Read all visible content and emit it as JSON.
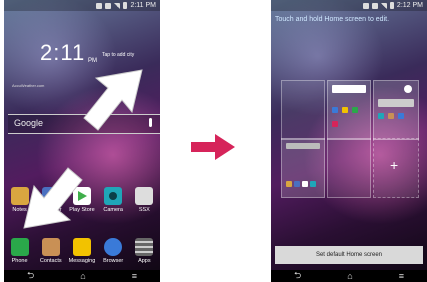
{
  "left_screen": {
    "status_time": "2:11 PM",
    "clock": "2:11",
    "clock_period": "PM",
    "tap_to_add_city": "Tap to add city",
    "weather_credit": "AccuWeather.com",
    "search_label": "Google",
    "app_row": [
      {
        "label": "Notes",
        "color": "#d9a640"
      },
      {
        "label": "xTheater",
        "color": "#4a70c0"
      },
      {
        "label": "Play Store",
        "color": "#ffffff"
      },
      {
        "label": "Camera",
        "color": "#1fa6b8"
      },
      {
        "label": "SSX",
        "color": "#dddddd"
      }
    ],
    "dock": [
      {
        "label": "Phone",
        "color": "#2aa84a"
      },
      {
        "label": "Contacts",
        "color": "#c99055"
      },
      {
        "label": "Messaging",
        "color": "#f2c200"
      },
      {
        "label": "Browser",
        "color": "#3a7ad8"
      },
      {
        "label": "Apps",
        "color": "#666666"
      }
    ]
  },
  "right_screen": {
    "status_time": "2:12 PM",
    "instruction": "Touch and hold Home screen to edit.",
    "add_symbol": "+",
    "set_default_label": "Set default Home screen"
  },
  "nav": {
    "back": "⮌",
    "home": "⌂",
    "menu": "≡"
  },
  "colors": {
    "transition_arrow": "#d6245a",
    "swipe_arrow": "#ffffff"
  }
}
